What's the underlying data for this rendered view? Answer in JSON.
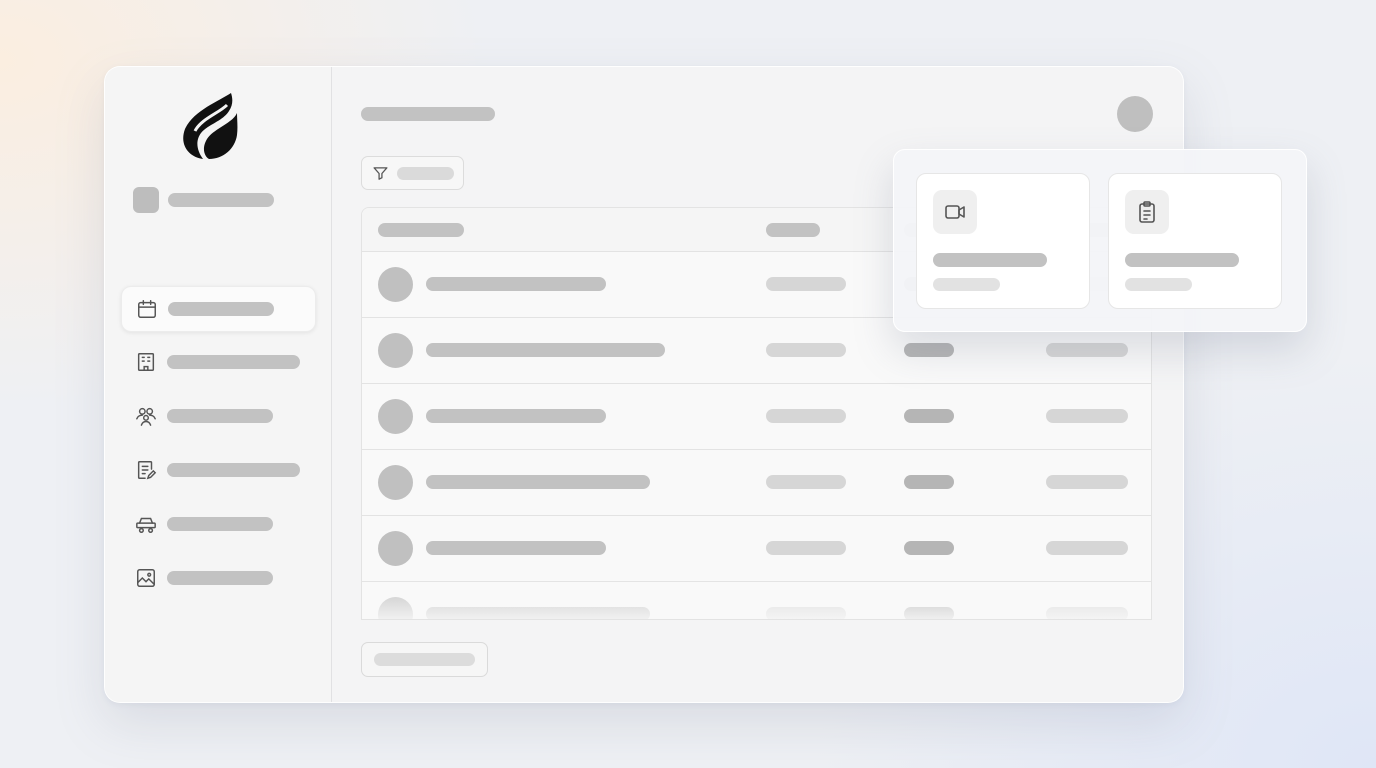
{
  "app": {
    "logo_icon": "flame-leaf-logo"
  },
  "sidebar": {
    "items": [
      {
        "icon": "calendar-icon",
        "active": true
      },
      {
        "icon": "building-icon",
        "active": false
      },
      {
        "icon": "users-icon",
        "active": false
      },
      {
        "icon": "notes-edit-icon",
        "active": false
      },
      {
        "icon": "car-icon",
        "active": false
      },
      {
        "icon": "image-icon",
        "active": false
      }
    ]
  },
  "toolbar": {
    "filter_icon": "filter-icon"
  },
  "table": {
    "row_count_visible": 6
  },
  "popover": {
    "cards": [
      {
        "icon": "video-icon"
      },
      {
        "icon": "clipboard-icon"
      }
    ]
  },
  "colors": {
    "placeholder_dark": "#b5b5b5",
    "placeholder": "#c2c2c2",
    "placeholder_light": "#d6d6d6",
    "window_bg": "#f4f4f5",
    "card_bg": "#ffffff"
  }
}
